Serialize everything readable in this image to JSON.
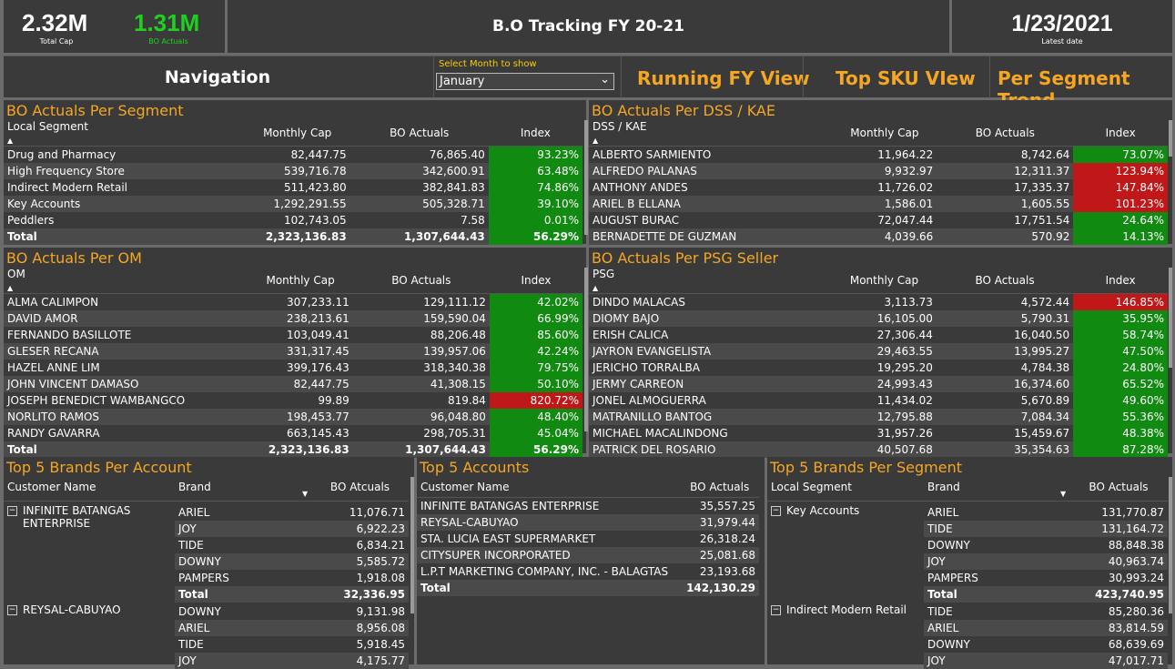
{
  "kpis": {
    "total_cap": "2.32M",
    "total_cap_label": "Total Cap",
    "bo_actuals": "1.31M",
    "bo_actuals_label": "BO Actuals"
  },
  "header": {
    "title": "B.O Tracking FY 20-21",
    "latest_date": "1/23/2021",
    "latest_date_label": "Latest date"
  },
  "nav": {
    "navigation_label": "Navigation",
    "month_label": "Select Month to show",
    "month_value": "January",
    "running_fy": "Running FY View",
    "top_sku": "Top SKU VIew",
    "per_segment_trend": "Per Segment Trend"
  },
  "colors": {
    "accent": "#f5a623",
    "kpi_green": "#1fd11f",
    "good": "#118a11",
    "bad": "#c01818"
  },
  "seg": {
    "title": "BO Actuals Per Segment",
    "cols": [
      "Local Segment",
      "Monthly Cap",
      "BO Actuals",
      "Index"
    ],
    "rows": [
      [
        "Drug and Pharmacy",
        "82,447.75",
        "76,865.40",
        "93.23%",
        "g"
      ],
      [
        "High Frequency Store",
        "539,716.78",
        "342,600.91",
        "63.48%",
        "g"
      ],
      [
        "Indirect Modern Retail",
        "511,423.80",
        "382,841.83",
        "74.86%",
        "g"
      ],
      [
        "Key Accounts",
        "1,292,291.55",
        "505,328.71",
        "39.10%",
        "g"
      ],
      [
        "Peddlers",
        "102,743.05",
        "7.58",
        "0.01%",
        "g"
      ],
      [
        "Total",
        "2,323,136.83",
        "1,307,644.43",
        "56.29%",
        "g"
      ]
    ]
  },
  "dss": {
    "title": "BO Actuals Per DSS / KAE",
    "cols": [
      "DSS / KAE",
      "Monthly Cap",
      "BO Actuals",
      "Index"
    ],
    "rows": [
      [
        "ALBERTO SARMIENTO",
        "11,964.22",
        "8,742.64",
        "73.07%",
        "g"
      ],
      [
        "ALFREDO PALANAS",
        "9,932.97",
        "12,311.37",
        "123.94%",
        "r"
      ],
      [
        "ANTHONY ANDES",
        "11,726.02",
        "17,335.37",
        "147.84%",
        "r"
      ],
      [
        "ARIEL B ELLANA",
        "1,586.01",
        "1,605.55",
        "101.23%",
        "r"
      ],
      [
        "AUGUST BURAC",
        "72,047.44",
        "17,751.54",
        "24.64%",
        "g"
      ],
      [
        "BERNADETTE DE GUZMAN",
        "4,039.66",
        "570.92",
        "14.13%",
        "g"
      ]
    ]
  },
  "om": {
    "title": "BO Actuals Per OM",
    "cols": [
      "OM",
      "Monthly Cap",
      "BO Actuals",
      "Index"
    ],
    "rows": [
      [
        "ALMA CALIMPON",
        "307,233.11",
        "129,111.12",
        "42.02%",
        "g"
      ],
      [
        "DAVID AMOR",
        "238,213.61",
        "159,590.04",
        "66.99%",
        "g"
      ],
      [
        "FERNANDO BASILLOTE",
        "103,049.41",
        "88,206.48",
        "85.60%",
        "g"
      ],
      [
        "GLESER RECANA",
        "331,317.45",
        "139,957.06",
        "42.24%",
        "g"
      ],
      [
        "HAZEL ANNE LIM",
        "399,176.43",
        "318,340.38",
        "79.75%",
        "g"
      ],
      [
        "JOHN VINCENT DAMASO",
        "82,447.75",
        "41,308.15",
        "50.10%",
        "g"
      ],
      [
        "JOSEPH BENEDICT WAMBANGCO",
        "99.89",
        "819.84",
        "820.72%",
        "r"
      ],
      [
        "NORLITO RAMOS",
        "198,453.77",
        "96,048.80",
        "48.40%",
        "g"
      ],
      [
        "RANDY GAVARRA",
        "663,145.43",
        "298,705.31",
        "45.04%",
        "g"
      ],
      [
        "Total",
        "2,323,136.83",
        "1,307,644.43",
        "56.29%",
        "g"
      ]
    ]
  },
  "psg": {
    "title": "BO Actuals Per PSG Seller",
    "cols": [
      "PSG",
      "Monthly Cap",
      "BO Actuals",
      "Index"
    ],
    "rows": [
      [
        "DINDO MALACAS",
        "3,113.73",
        "4,572.44",
        "146.85%",
        "r"
      ],
      [
        "DIOMY BAJO",
        "16,105.00",
        "5,790.31",
        "35.95%",
        "g"
      ],
      [
        "ERISH CALICA",
        "27,306.44",
        "16,040.50",
        "58.74%",
        "g"
      ],
      [
        "JAYRON EVANGELISTA",
        "29,463.55",
        "13,995.27",
        "47.50%",
        "g"
      ],
      [
        "JERICHO TORRALBA",
        "19,295.20",
        "4,784.38",
        "24.80%",
        "g"
      ],
      [
        "JERMY CARREON",
        "24,993.43",
        "16,374.60",
        "65.52%",
        "g"
      ],
      [
        "JONEL ALMOGUERRA",
        "11,434.02",
        "5,670.89",
        "49.60%",
        "g"
      ],
      [
        "MATRANILLO BANTOG",
        "12,795.88",
        "7,084.34",
        "55.36%",
        "g"
      ],
      [
        "MICHAEL MACALINDONG",
        "31,957.26",
        "15,459.67",
        "48.38%",
        "g"
      ],
      [
        "PATRICK DEL ROSARIO",
        "40,507.68",
        "35,354.63",
        "87.28%",
        "g"
      ]
    ]
  },
  "brands_acct": {
    "title": "Top 5 Brands Per Account",
    "cols": [
      "Customer Name",
      "Brand",
      "BO Atcuals"
    ],
    "groups": [
      {
        "name_lines": [
          "INFINITE BATANGAS",
          "ENTERPRISE"
        ],
        "rows": [
          [
            "ARIEL",
            "11,076.71"
          ],
          [
            "JOY",
            "6,922.23"
          ],
          [
            "TIDE",
            "6,834.21"
          ],
          [
            "DOWNY",
            "5,585.72"
          ],
          [
            "PAMPERS",
            "1,918.08"
          ],
          [
            "Total",
            "32,336.95"
          ]
        ]
      },
      {
        "name_lines": [
          "REYSAL-CABUYAO"
        ],
        "rows": [
          [
            "DOWNY",
            "9,131.98"
          ],
          [
            "ARIEL",
            "8,956.08"
          ],
          [
            "TIDE",
            "5,918.45"
          ],
          [
            "JOY",
            "4,175.77"
          ]
        ]
      }
    ]
  },
  "accounts": {
    "title": "Top 5 Accounts",
    "cols": [
      "Customer Name",
      "BO Actuals"
    ],
    "rows": [
      [
        "INFINITE BATANGAS ENTERPRISE",
        "35,557.25"
      ],
      [
        "REYSAL-CABUYAO",
        "31,979.44"
      ],
      [
        "STA. LUCIA EAST SUPERMARKET",
        "26,318.24"
      ],
      [
        "CITYSUPER INCORPORATED",
        "25,081.68"
      ],
      [
        "L.P.T MARKETING COMPANY, INC. - BALAGTAS",
        "23,193.68"
      ],
      [
        "Total",
        "142,130.29"
      ]
    ]
  },
  "brands_seg": {
    "title": "Top 5 Brands Per Segment",
    "cols": [
      "Local Segment",
      "Brand",
      "BO Actuals"
    ],
    "groups": [
      {
        "name": "Key Accounts",
        "rows": [
          [
            "ARIEL",
            "131,770.87"
          ],
          [
            "TIDE",
            "131,164.72"
          ],
          [
            "DOWNY",
            "88,848.38"
          ],
          [
            "JOY",
            "40,963.74"
          ],
          [
            "PAMPERS",
            "30,993.24"
          ],
          [
            "Total",
            "423,740.95"
          ]
        ]
      },
      {
        "name": "Indirect Modern Retail",
        "rows": [
          [
            "TIDE",
            "85,280.36"
          ],
          [
            "ARIEL",
            "83,814.59"
          ],
          [
            "DOWNY",
            "68,639.69"
          ],
          [
            "JOY",
            "47,017.71"
          ]
        ]
      }
    ]
  }
}
